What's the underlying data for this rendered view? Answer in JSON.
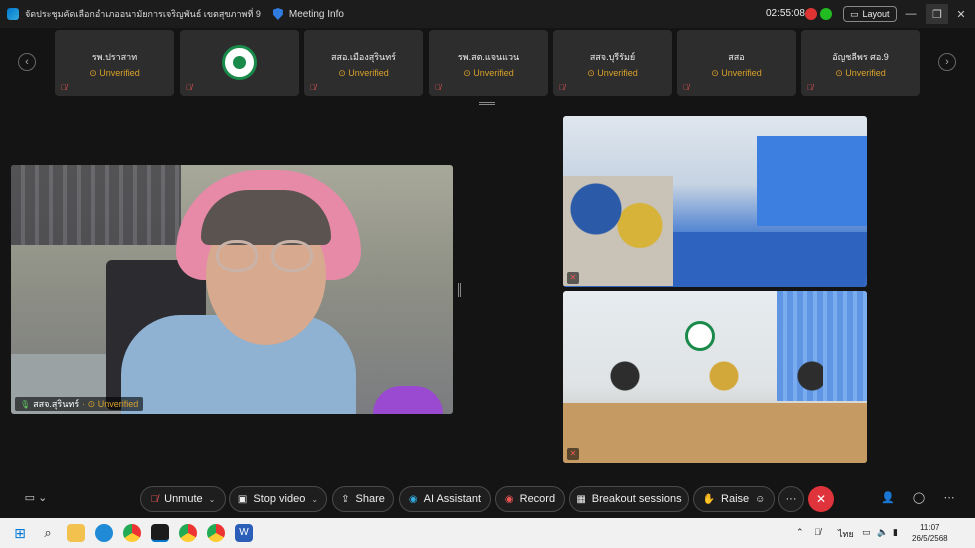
{
  "window": {
    "meeting_title": "จัดประชุมคัดเลือกอำเภออนามัยการเจริญพันธ์ เขตสุขภาพที่ 9",
    "meeting_info": "Meeting Info",
    "timer": "02:55:08",
    "layout_label": "Layout"
  },
  "participants": [
    {
      "name": "รพ.ปราสาท",
      "status": "Unverified"
    },
    {
      "name": "",
      "status": ""
    },
    {
      "name": "สสอ.เมืองสุรินทร์",
      "status": "Unverified"
    },
    {
      "name": "รพ.สต.แจนแวน",
      "status": "Unverified"
    },
    {
      "name": "สสจ.บุรีรัมย์",
      "status": "Unverified"
    },
    {
      "name": "สสอ",
      "status": "Unverified"
    },
    {
      "name": "อัญชลีพร ศอ.9",
      "status": "Unverified"
    }
  ],
  "main_video": {
    "name": "สสจ.สุรินทร์",
    "status": "Unverified"
  },
  "toolbar": {
    "unmute": "Unmute",
    "stop_video": "Stop video",
    "share": "Share",
    "ai_assistant": "AI Assistant",
    "record": "Record",
    "breakout": "Breakout sessions",
    "raise": "Raise",
    "more": "···"
  },
  "taskbar": {
    "lang": "ไทย",
    "time": "11:07",
    "date": "26/5/2568"
  },
  "colors": {
    "unverified": "#d9a12a",
    "leave": "#e0343d",
    "accent": "#2f7be0"
  }
}
